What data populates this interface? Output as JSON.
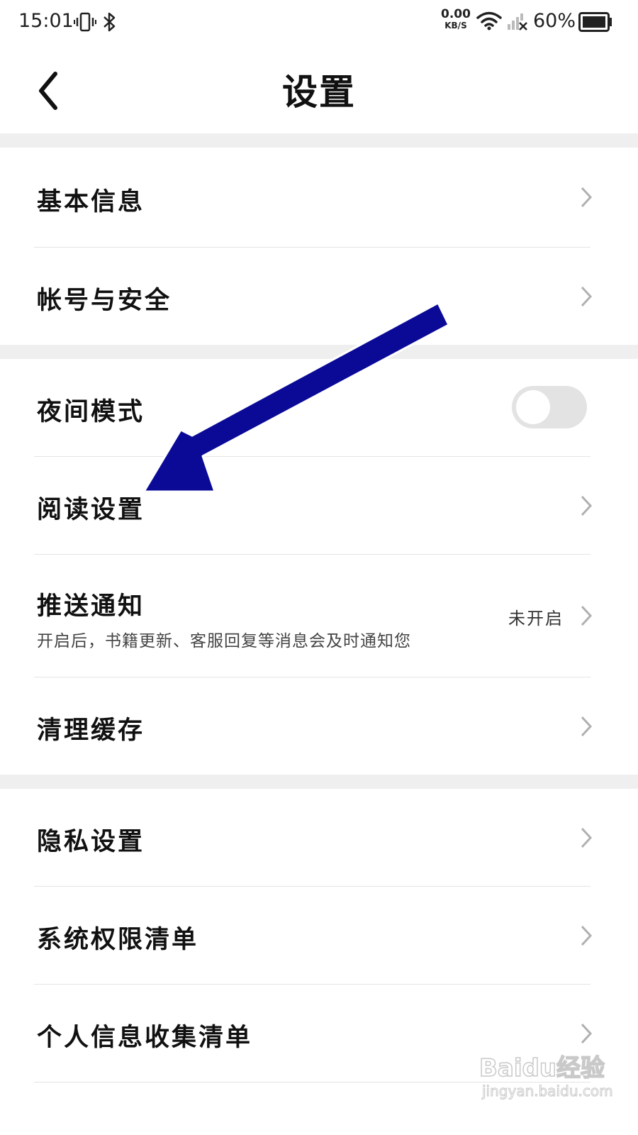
{
  "status_bar": {
    "time": "15:01",
    "net_speed_value": "0.00",
    "net_speed_unit": "KB/S",
    "battery_percent": "60%",
    "icons": [
      "vibrate-icon",
      "bluetooth-icon",
      "wifi-icon",
      "cellular-no-signal-icon",
      "battery-icon"
    ]
  },
  "header": {
    "title": "设置",
    "back_icon": "back-arrow-icon"
  },
  "sections": [
    {
      "items": [
        {
          "label": "基本信息",
          "control": "chevron"
        },
        {
          "label": "帐号与安全",
          "control": "chevron"
        }
      ]
    },
    {
      "items": [
        {
          "label": "夜间模式",
          "control": "toggle",
          "toggle_on": false
        },
        {
          "label": "阅读设置",
          "control": "chevron"
        },
        {
          "label": "推送通知",
          "sub": "开启后，书籍更新、客服回复等消息会及时通知您",
          "value": "未开启",
          "control": "chevron"
        },
        {
          "label": "清理缓存",
          "control": "chevron"
        }
      ]
    },
    {
      "items": [
        {
          "label": "隐私设置",
          "control": "chevron"
        },
        {
          "label": "系统权限清单",
          "control": "chevron"
        },
        {
          "label": "个人信息收集清单",
          "control": "chevron"
        }
      ]
    }
  ],
  "annotation": {
    "color": "#0a0a96",
    "points_to": "阅读设置"
  },
  "watermark": {
    "logo": "Baidu经验",
    "site": "jingyan.baidu.com"
  },
  "colors": {
    "section_gap": "#efefef",
    "divider": "#e4e4e4",
    "toggle_off": "#e3e3e3"
  }
}
